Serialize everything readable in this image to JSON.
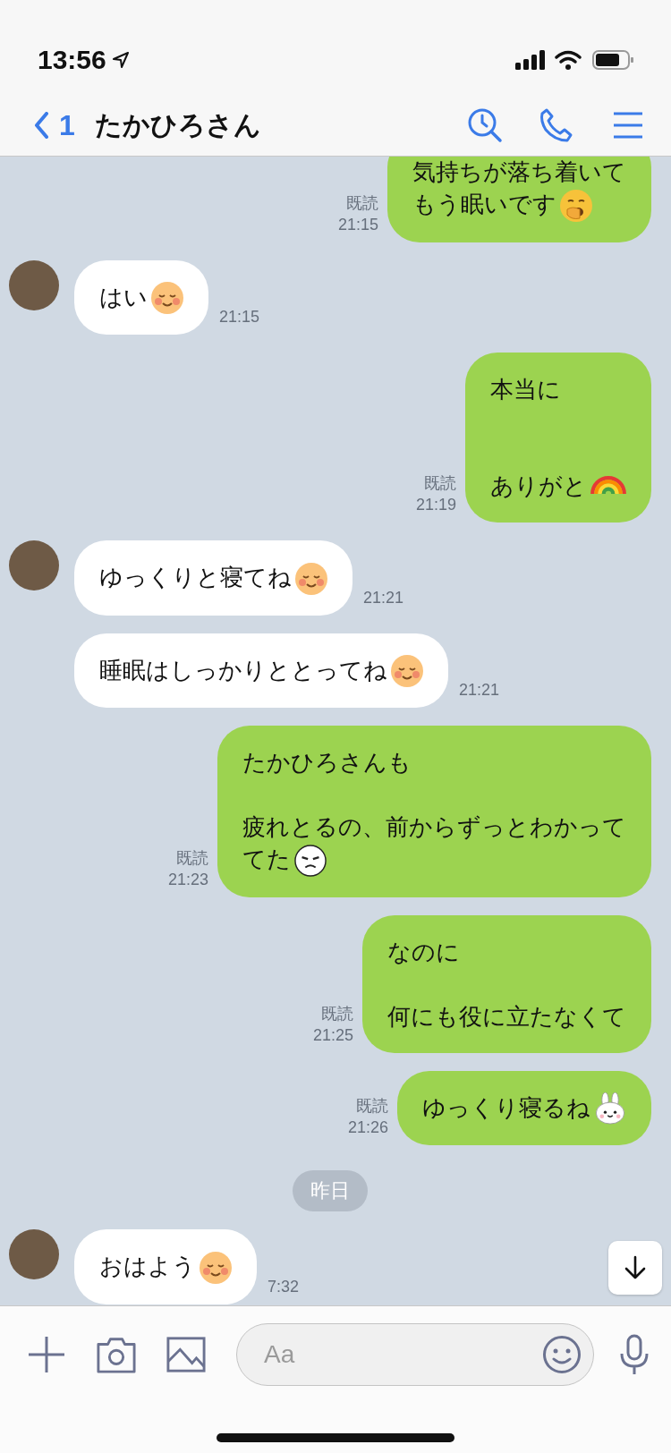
{
  "status_bar": {
    "time": "13:56"
  },
  "header": {
    "back_count": "1",
    "title": "たかひろさん"
  },
  "messages": [
    {
      "kind": "sent",
      "paragraphs": [
        [
          "気持ちが落ち着いて",
          "もう眠いです"
        ]
      ],
      "emoji": {
        "kind": "yawn"
      },
      "read": "既読",
      "time": "21:15"
    },
    {
      "kind": "received",
      "avatar": true,
      "paragraphs": [
        [
          "はい"
        ]
      ],
      "emoji": {
        "kind": "blush"
      },
      "time": "21:15"
    },
    {
      "kind": "sent",
      "paragraphs": [
        [
          "本当に"
        ],
        [
          "ありがと"
        ]
      ],
      "wide_gap": true,
      "emoji": {
        "kind": "rainbow"
      },
      "read": "既読",
      "time": "21:19"
    },
    {
      "kind": "received",
      "avatar": true,
      "paragraphs": [
        [
          "ゆっくりと寝てね"
        ]
      ],
      "emoji": {
        "kind": "blush"
      },
      "time": "21:21"
    },
    {
      "kind": "received",
      "avatar": false,
      "paragraphs": [
        [
          "睡眠はしっかりととってね"
        ]
      ],
      "emoji": {
        "kind": "blush"
      },
      "time": "21:21"
    },
    {
      "kind": "sent",
      "paragraphs": [
        [
          "たかひろさんも"
        ],
        [
          "疲れとるの、前からずっとわかって",
          "てた"
        ]
      ],
      "emoji": {
        "kind": "sad"
      },
      "read": "既読",
      "time": "21:23"
    },
    {
      "kind": "sent",
      "paragraphs": [
        [
          "なのに"
        ],
        [
          "何にも役に立たなくて"
        ]
      ],
      "read": "既読",
      "time": "21:25"
    },
    {
      "kind": "sent",
      "paragraphs": [
        [
          "ゆっくり寝るね"
        ]
      ],
      "emoji": {
        "kind": "rabbit"
      },
      "read": "既読",
      "time": "21:26"
    },
    {
      "kind": "date",
      "text": "昨日"
    },
    {
      "kind": "received",
      "avatar": true,
      "paragraphs": [
        [
          "おはよう"
        ]
      ],
      "emoji": {
        "kind": "blush"
      },
      "time": "7:32"
    }
  ],
  "input": {
    "placeholder": "Aa"
  }
}
